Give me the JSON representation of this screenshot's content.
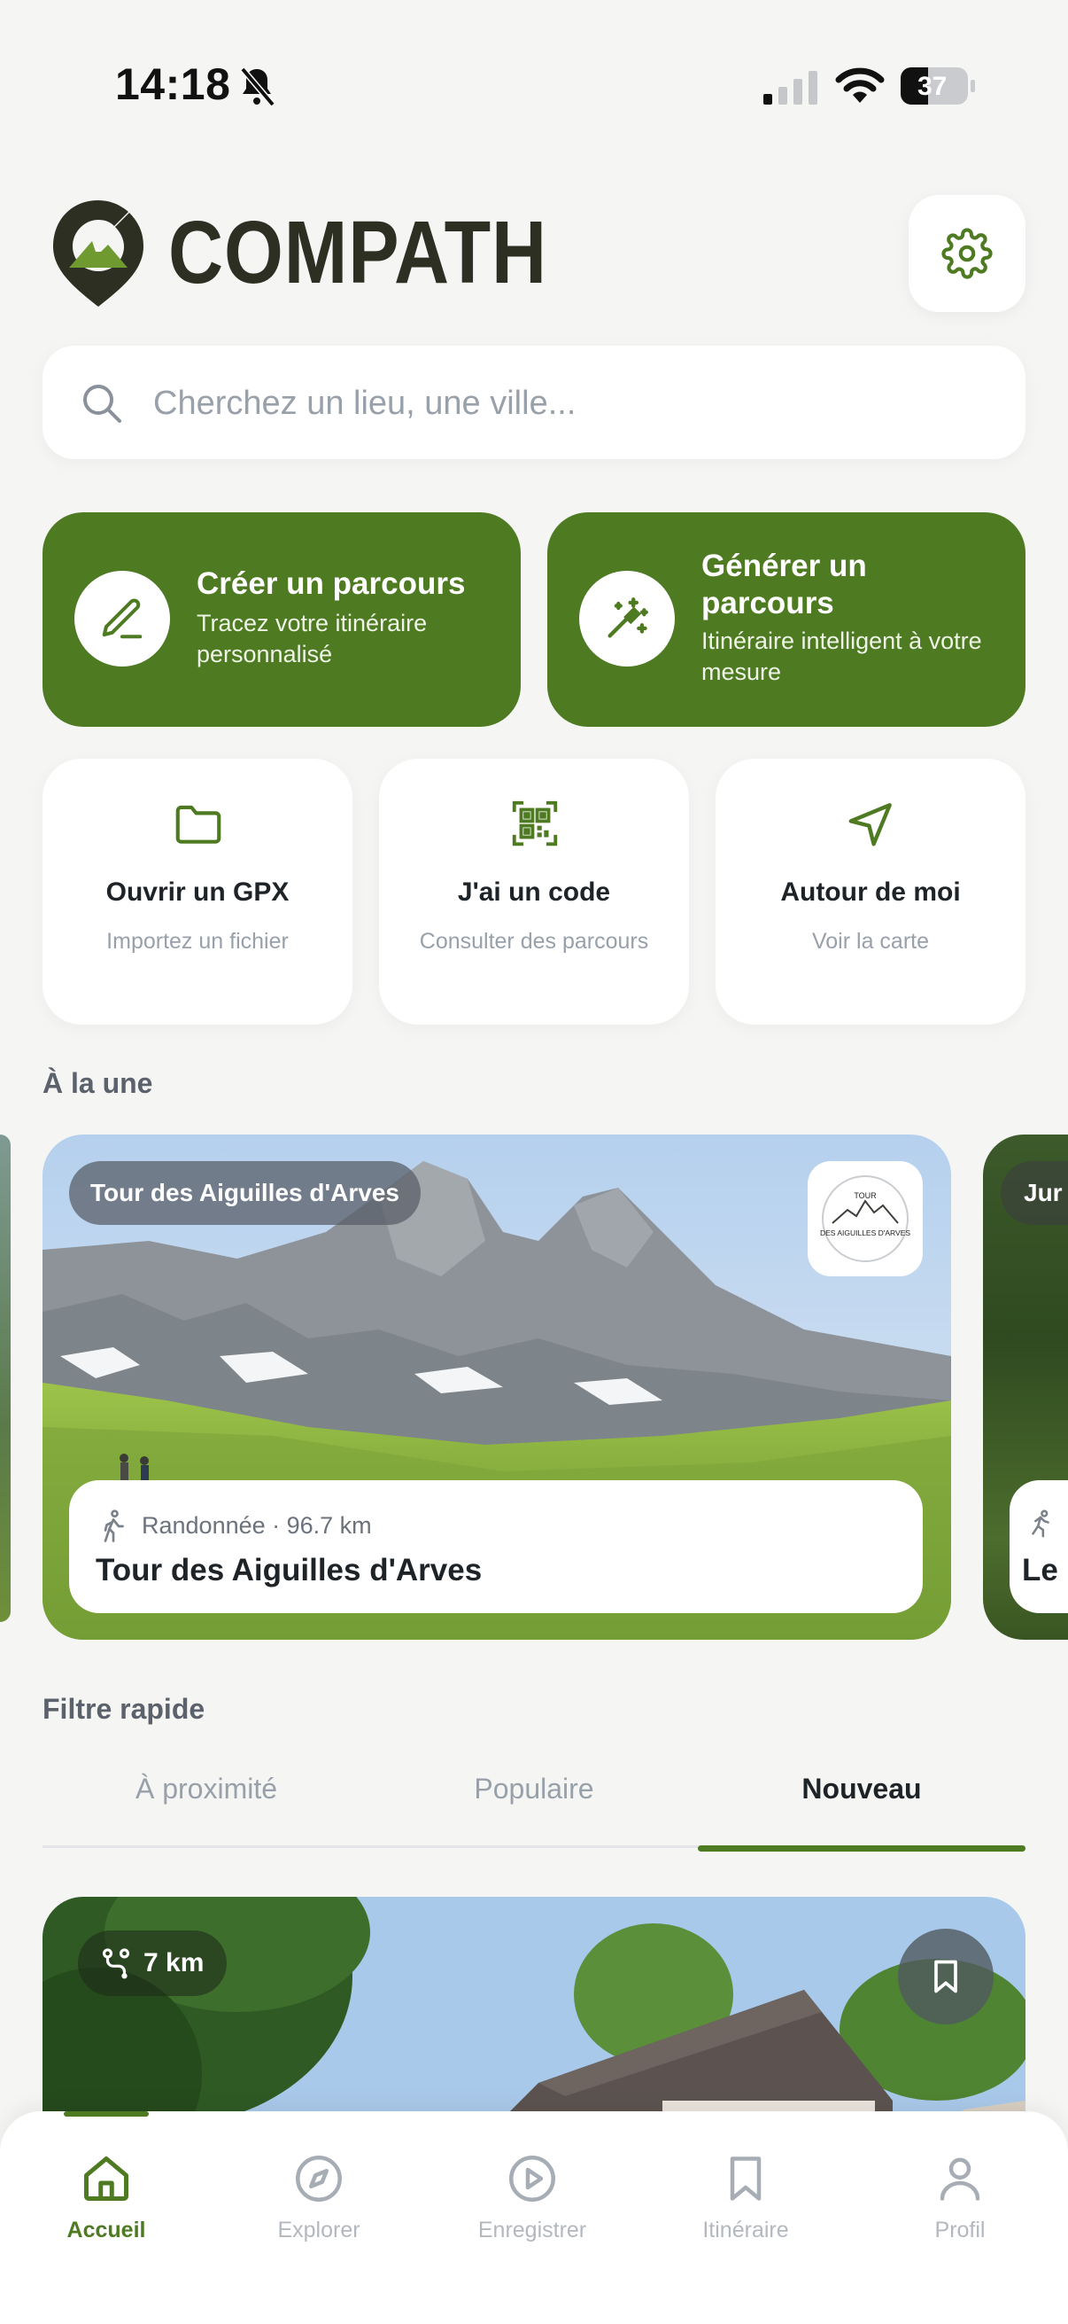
{
  "status_bar": {
    "time": "14:18",
    "battery": "37"
  },
  "header": {
    "brand": "COMPATH"
  },
  "search": {
    "placeholder": "Cherchez un lieu, une ville..."
  },
  "actions": {
    "create": {
      "title": "Créer un parcours",
      "subtitle": "Tracez votre itinéraire personnalisé"
    },
    "generate": {
      "title": "Générer un parcours",
      "subtitle": "Itinéraire intelligent à votre mesure"
    }
  },
  "quick_cards": [
    {
      "title": "Ouvrir un GPX",
      "subtitle": "Importez un fichier",
      "icon": "folder-icon"
    },
    {
      "title": "J'ai un code",
      "subtitle": "Consulter des parcours",
      "icon": "qr-code-icon"
    },
    {
      "title": "Autour de moi",
      "subtitle": "Voir la carte",
      "icon": "navigation-arrow-icon"
    }
  ],
  "featured": {
    "label": "À la une",
    "card": {
      "badge": "Tour des Aiguilles d'Arves",
      "logo_text_top": "TOUR",
      "logo_text_bottom": "DES AIGUILLES D'ARVES",
      "meta": "Randonnée · 96.7 km",
      "name": "Tour des Aiguilles d'Arves"
    },
    "next_card": {
      "badge": "Jur",
      "name": "Le"
    }
  },
  "quick_filter": {
    "label": "Filtre rapide",
    "tabs": [
      "À proximité",
      "Populaire",
      "Nouveau"
    ],
    "active_tab": "Nouveau"
  },
  "route_card": {
    "distance": "7 km"
  },
  "bottom_nav": {
    "items": [
      "Accueil",
      "Explorer",
      "Enregistrer",
      "Itinéraire",
      "Profil"
    ],
    "active": "Accueil"
  },
  "colors": {
    "accent": "#4e7a22",
    "background": "#f5f5f4",
    "muted": "#98a0aa"
  }
}
